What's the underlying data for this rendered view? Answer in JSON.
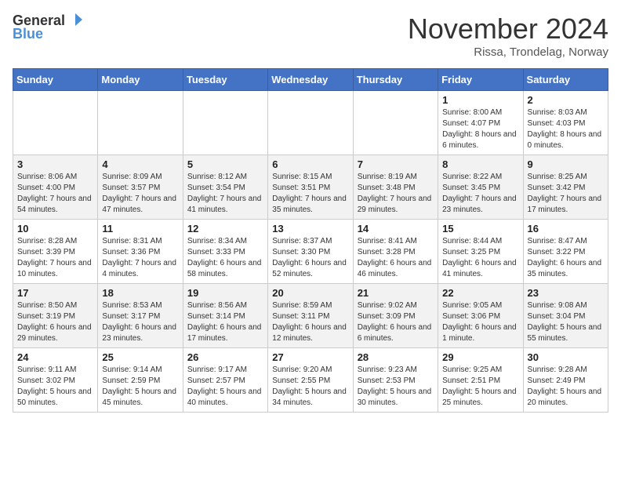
{
  "header": {
    "logo_general": "General",
    "logo_blue": "Blue",
    "title": "November 2024",
    "subtitle": "Rissa, Trondelag, Norway"
  },
  "weekdays": [
    "Sunday",
    "Monday",
    "Tuesday",
    "Wednesday",
    "Thursday",
    "Friday",
    "Saturday"
  ],
  "weeks": [
    [
      {
        "day": "",
        "info": ""
      },
      {
        "day": "",
        "info": ""
      },
      {
        "day": "",
        "info": ""
      },
      {
        "day": "",
        "info": ""
      },
      {
        "day": "",
        "info": ""
      },
      {
        "day": "1",
        "info": "Sunrise: 8:00 AM\nSunset: 4:07 PM\nDaylight: 8 hours and 6 minutes."
      },
      {
        "day": "2",
        "info": "Sunrise: 8:03 AM\nSunset: 4:03 PM\nDaylight: 8 hours and 0 minutes."
      }
    ],
    [
      {
        "day": "3",
        "info": "Sunrise: 8:06 AM\nSunset: 4:00 PM\nDaylight: 7 hours and 54 minutes."
      },
      {
        "day": "4",
        "info": "Sunrise: 8:09 AM\nSunset: 3:57 PM\nDaylight: 7 hours and 47 minutes."
      },
      {
        "day": "5",
        "info": "Sunrise: 8:12 AM\nSunset: 3:54 PM\nDaylight: 7 hours and 41 minutes."
      },
      {
        "day": "6",
        "info": "Sunrise: 8:15 AM\nSunset: 3:51 PM\nDaylight: 7 hours and 35 minutes."
      },
      {
        "day": "7",
        "info": "Sunrise: 8:19 AM\nSunset: 3:48 PM\nDaylight: 7 hours and 29 minutes."
      },
      {
        "day": "8",
        "info": "Sunrise: 8:22 AM\nSunset: 3:45 PM\nDaylight: 7 hours and 23 minutes."
      },
      {
        "day": "9",
        "info": "Sunrise: 8:25 AM\nSunset: 3:42 PM\nDaylight: 7 hours and 17 minutes."
      }
    ],
    [
      {
        "day": "10",
        "info": "Sunrise: 8:28 AM\nSunset: 3:39 PM\nDaylight: 7 hours and 10 minutes."
      },
      {
        "day": "11",
        "info": "Sunrise: 8:31 AM\nSunset: 3:36 PM\nDaylight: 7 hours and 4 minutes."
      },
      {
        "day": "12",
        "info": "Sunrise: 8:34 AM\nSunset: 3:33 PM\nDaylight: 6 hours and 58 minutes."
      },
      {
        "day": "13",
        "info": "Sunrise: 8:37 AM\nSunset: 3:30 PM\nDaylight: 6 hours and 52 minutes."
      },
      {
        "day": "14",
        "info": "Sunrise: 8:41 AM\nSunset: 3:28 PM\nDaylight: 6 hours and 46 minutes."
      },
      {
        "day": "15",
        "info": "Sunrise: 8:44 AM\nSunset: 3:25 PM\nDaylight: 6 hours and 41 minutes."
      },
      {
        "day": "16",
        "info": "Sunrise: 8:47 AM\nSunset: 3:22 PM\nDaylight: 6 hours and 35 minutes."
      }
    ],
    [
      {
        "day": "17",
        "info": "Sunrise: 8:50 AM\nSunset: 3:19 PM\nDaylight: 6 hours and 29 minutes."
      },
      {
        "day": "18",
        "info": "Sunrise: 8:53 AM\nSunset: 3:17 PM\nDaylight: 6 hours and 23 minutes."
      },
      {
        "day": "19",
        "info": "Sunrise: 8:56 AM\nSunset: 3:14 PM\nDaylight: 6 hours and 17 minutes."
      },
      {
        "day": "20",
        "info": "Sunrise: 8:59 AM\nSunset: 3:11 PM\nDaylight: 6 hours and 12 minutes."
      },
      {
        "day": "21",
        "info": "Sunrise: 9:02 AM\nSunset: 3:09 PM\nDaylight: 6 hours and 6 minutes."
      },
      {
        "day": "22",
        "info": "Sunrise: 9:05 AM\nSunset: 3:06 PM\nDaylight: 6 hours and 1 minute."
      },
      {
        "day": "23",
        "info": "Sunrise: 9:08 AM\nSunset: 3:04 PM\nDaylight: 5 hours and 55 minutes."
      }
    ],
    [
      {
        "day": "24",
        "info": "Sunrise: 9:11 AM\nSunset: 3:02 PM\nDaylight: 5 hours and 50 minutes."
      },
      {
        "day": "25",
        "info": "Sunrise: 9:14 AM\nSunset: 2:59 PM\nDaylight: 5 hours and 45 minutes."
      },
      {
        "day": "26",
        "info": "Sunrise: 9:17 AM\nSunset: 2:57 PM\nDaylight: 5 hours and 40 minutes."
      },
      {
        "day": "27",
        "info": "Sunrise: 9:20 AM\nSunset: 2:55 PM\nDaylight: 5 hours and 34 minutes."
      },
      {
        "day": "28",
        "info": "Sunrise: 9:23 AM\nSunset: 2:53 PM\nDaylight: 5 hours and 30 minutes."
      },
      {
        "day": "29",
        "info": "Sunrise: 9:25 AM\nSunset: 2:51 PM\nDaylight: 5 hours and 25 minutes."
      },
      {
        "day": "30",
        "info": "Sunrise: 9:28 AM\nSunset: 2:49 PM\nDaylight: 5 hours and 20 minutes."
      }
    ]
  ]
}
